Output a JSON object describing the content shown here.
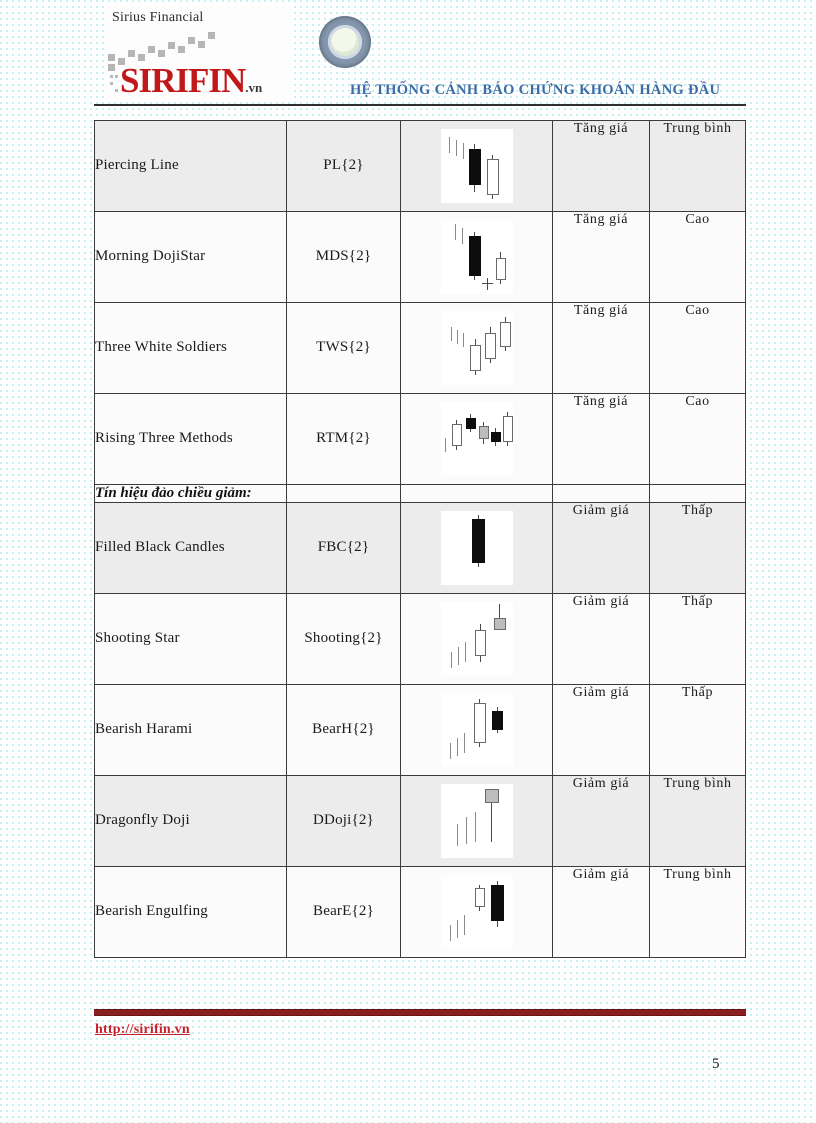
{
  "document": {
    "header": {
      "logo_tagline": "Sirius Financial",
      "logo_name": "SIRIFIN",
      "logo_tld": ".vn",
      "title": "HỆ THỐNG CẢNH BÁO CHỨNG KHOÁN HÀNG ĐẦU"
    },
    "footer": {
      "url": "http://sirifin.vn",
      "page_number": "5"
    },
    "table": {
      "rows": [
        {
          "type": "pattern",
          "name": "Piercing Line",
          "code": "PL{2}",
          "signal": "Tăng giá",
          "level": "Trung bình",
          "chart": "piercing-line"
        },
        {
          "type": "pattern",
          "name": "Morning DojiStar",
          "code": "MDS{2}",
          "signal": "Tăng giá",
          "level": "Cao",
          "chart": "morning-doji-star"
        },
        {
          "type": "pattern",
          "name": "Three White Soldiers",
          "code": "TWS{2}",
          "signal": "Tăng giá",
          "level": "Cao",
          "chart": "three-white-soldiers"
        },
        {
          "type": "pattern",
          "name": "Rising Three Methods",
          "code": "RTM{2}",
          "signal": "Tăng giá",
          "level": "Cao",
          "chart": "rising-three-methods"
        },
        {
          "type": "section",
          "name": "Tín hiệu đảo chiều giảm:",
          "code": "",
          "signal": "",
          "level": "",
          "chart": ""
        },
        {
          "type": "pattern",
          "name": "Filled Black Candles",
          "code": "FBC{2}",
          "signal": "Giảm giá",
          "level": "Thấp",
          "chart": "filled-black-candles"
        },
        {
          "type": "pattern",
          "name": "Shooting Star",
          "code": "Shooting{2}",
          "signal": "Giảm giá",
          "level": "Thấp",
          "chart": "shooting-star"
        },
        {
          "type": "pattern",
          "name": "Bearish Harami",
          "code": "BearH{2}",
          "signal": "Giảm giá",
          "level": "Thấp",
          "chart": "bearish-harami"
        },
        {
          "type": "pattern",
          "name": "Dragonfly Doji",
          "code": "DDoji{2}",
          "signal": "Giảm giá",
          "level": "Trung bình",
          "chart": "dragonfly-doji"
        },
        {
          "type": "pattern",
          "name": "Bearish Engulfing",
          "code": "BearE{2}",
          "signal": "Giảm giá",
          "level": "Trung bình",
          "chart": "bearish-engulfing"
        }
      ]
    },
    "colors": {
      "brand_red": "#c01818",
      "header_blue": "#3a6ba5",
      "footer_bar": "#8a1f1f",
      "link_red": "#c8202a"
    }
  }
}
